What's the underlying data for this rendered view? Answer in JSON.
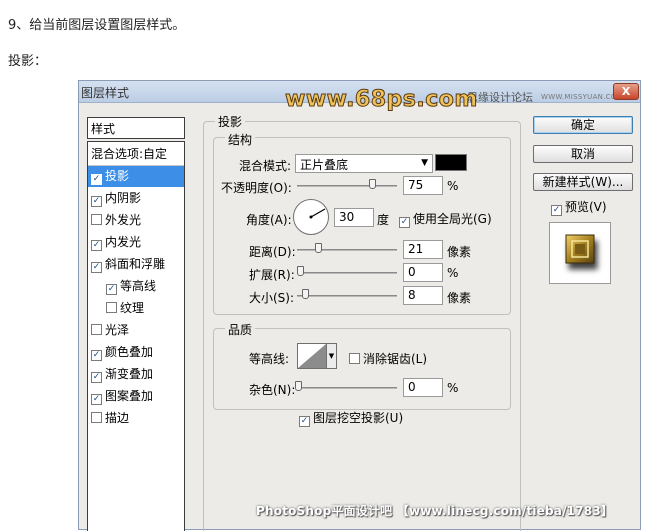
{
  "intro": {
    "step_text": "9、给当前图层设置图层样式。",
    "section_text": "投影："
  },
  "dialog": {
    "title": "图层样式",
    "site_name": "思缘设计论坛",
    "site_url": "WWW.MISSYUAN.COM",
    "watermark": "www.68ps.com",
    "close_glyph": "X"
  },
  "styles_panel": {
    "header": "样式",
    "items": [
      {
        "label": "混合选项:自定",
        "checkbox": false,
        "checked": false,
        "selected": false,
        "indent": false
      },
      {
        "label": "投影",
        "checkbox": true,
        "checked": true,
        "selected": true,
        "indent": false
      },
      {
        "label": "内阴影",
        "checkbox": true,
        "checked": true,
        "selected": false,
        "indent": false
      },
      {
        "label": "外发光",
        "checkbox": true,
        "checked": false,
        "selected": false,
        "indent": false
      },
      {
        "label": "内发光",
        "checkbox": true,
        "checked": true,
        "selected": false,
        "indent": false
      },
      {
        "label": "斜面和浮雕",
        "checkbox": true,
        "checked": true,
        "selected": false,
        "indent": false
      },
      {
        "label": "等高线",
        "checkbox": true,
        "checked": true,
        "selected": false,
        "indent": true
      },
      {
        "label": "纹理",
        "checkbox": true,
        "checked": false,
        "selected": false,
        "indent": true
      },
      {
        "label": "光泽",
        "checkbox": true,
        "checked": false,
        "selected": false,
        "indent": false
      },
      {
        "label": "颜色叠加",
        "checkbox": true,
        "checked": true,
        "selected": false,
        "indent": false
      },
      {
        "label": "渐变叠加",
        "checkbox": true,
        "checked": true,
        "selected": false,
        "indent": false
      },
      {
        "label": "图案叠加",
        "checkbox": true,
        "checked": true,
        "selected": false,
        "indent": false
      },
      {
        "label": "描边",
        "checkbox": true,
        "checked": false,
        "selected": false,
        "indent": false
      }
    ]
  },
  "drop_shadow": {
    "title": "投影",
    "structure_title": "结构",
    "blend_mode_label": "混合模式:",
    "blend_mode_value": "正片叠底",
    "shadow_color": "#000000",
    "opacity_label": "不透明度(O):",
    "opacity_value": "75",
    "opacity_unit": "%",
    "angle_label": "角度(A):",
    "angle_value": "30",
    "angle_unit": "度",
    "global_light_label": "使用全局光(G)",
    "global_light_checked": true,
    "distance_label": "距离(D):",
    "distance_value": "21",
    "distance_unit": "像素",
    "spread_label": "扩展(R):",
    "spread_value": "0",
    "spread_unit": "%",
    "size_label": "大小(S):",
    "size_value": "8",
    "size_unit": "像素",
    "quality_title": "品质",
    "contour_label": "等高线:",
    "antialias_label": "消除锯齿(L)",
    "antialias_checked": false,
    "noise_label": "杂色(N):",
    "noise_value": "0",
    "noise_unit": "%",
    "knockout_label": "图层挖空投影(U)",
    "knockout_checked": true
  },
  "actions": {
    "ok": "确定",
    "cancel": "取消",
    "new_style": "新建样式(W)...",
    "preview_label": "预览(V)",
    "preview_checked": true
  },
  "footer": {
    "text": "PhotoShop平面设计吧 【www.linecg.com/tieba/1783】"
  },
  "colors": {
    "selection": "#3d8ee6",
    "title_bar": "#c9d7ea",
    "close_button": "#c9452a"
  }
}
